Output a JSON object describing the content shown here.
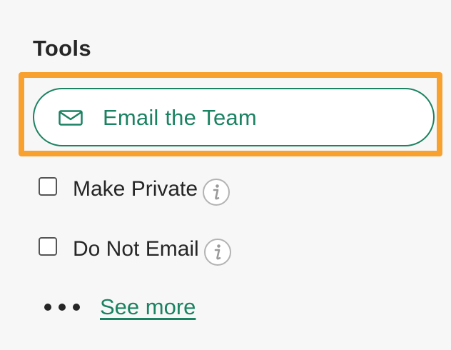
{
  "tools": {
    "heading": "Tools",
    "email_button_label": "Email the Team",
    "options": [
      {
        "label": "Make Private",
        "checked": false,
        "info_icon": "info-icon"
      },
      {
        "label": "Do Not Email",
        "checked": false,
        "info_icon": "info-icon"
      }
    ],
    "see_more_label": "See more",
    "more_icon": "ellipsis-icon"
  },
  "colors": {
    "accent": "#1b8262",
    "highlight": "#f8a12f",
    "background": "#f7f7f7",
    "text": "#262626"
  }
}
